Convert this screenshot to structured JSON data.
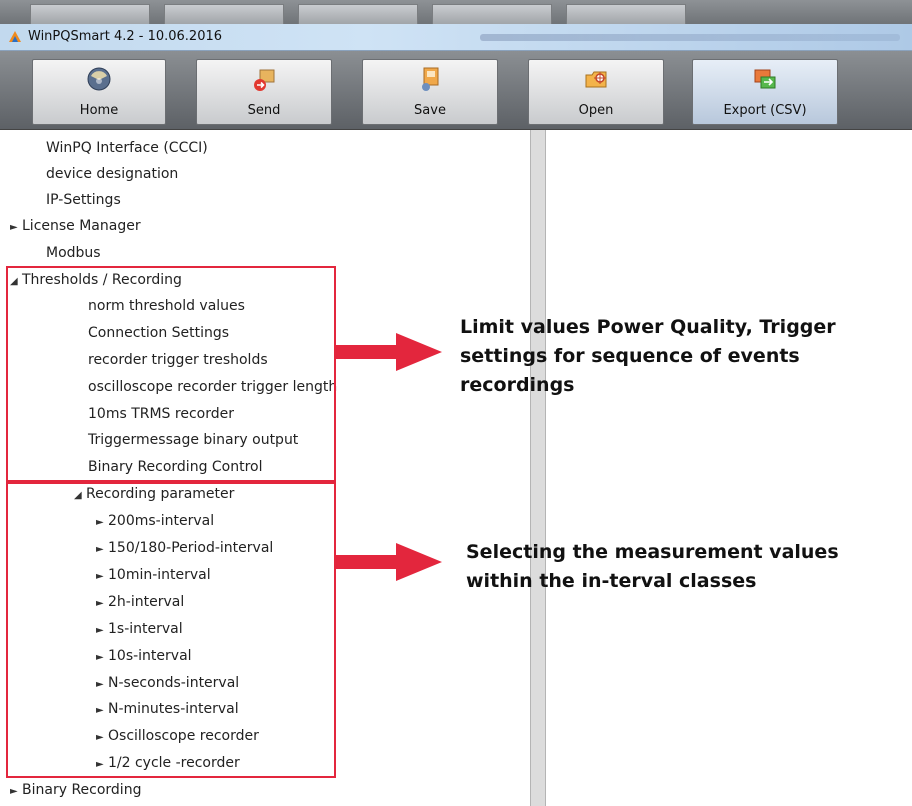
{
  "window": {
    "title": "WinPQSmart  4.2 - 10.06.2016"
  },
  "toolbar": {
    "buttons": [
      {
        "label": "Home",
        "icon": "home-icon"
      },
      {
        "label": "Send",
        "icon": "send-icon"
      },
      {
        "label": "Save",
        "icon": "save-icon"
      },
      {
        "label": "Open",
        "icon": "open-icon"
      },
      {
        "label": "Export (CSV)",
        "icon": "export-icon"
      }
    ]
  },
  "tree": {
    "items": [
      {
        "label": "WinPQ Interface (CCCI)",
        "expander": ""
      },
      {
        "label": "device designation",
        "expander": ""
      },
      {
        "label": "IP-Settings",
        "expander": ""
      },
      {
        "label": "License Manager",
        "expander": "►"
      },
      {
        "label": "Modbus",
        "expander": ""
      },
      {
        "label": "Thresholds / Recording",
        "expander": "◢"
      },
      {
        "label": "norm threshold values",
        "expander": ""
      },
      {
        "label": "Connection Settings",
        "expander": ""
      },
      {
        "label": "recorder trigger tresholds",
        "expander": ""
      },
      {
        "label": "oscilloscope  recorder trigger  length",
        "expander": ""
      },
      {
        "label": "10ms TRMS recorder",
        "expander": ""
      },
      {
        "label": "Triggermessage binary output",
        "expander": ""
      },
      {
        "label": "Binary Recording Control",
        "expander": ""
      },
      {
        "label": "Recording parameter",
        "expander": "◢"
      },
      {
        "label": "200ms-interval",
        "expander": "►"
      },
      {
        "label": "150/180-Period-interval",
        "expander": "►"
      },
      {
        "label": "10min-interval",
        "expander": "►"
      },
      {
        "label": "2h-interval",
        "expander": "►"
      },
      {
        "label": "1s-interval",
        "expander": "►"
      },
      {
        "label": "10s-interval",
        "expander": "►"
      },
      {
        "label": "N-seconds-interval",
        "expander": "►"
      },
      {
        "label": "N-minutes-interval",
        "expander": "►"
      },
      {
        "label": "Oscilloscope recorder",
        "expander": "►"
      },
      {
        "label": "1/2 cycle -recorder",
        "expander": "►"
      },
      {
        "label": "Binary Recording",
        "expander": "►"
      }
    ]
  },
  "annotations": {
    "note1": [
      "Limit values Power Quality, Trigger",
      "settings for sequence of events",
      "recordings"
    ],
    "note2": [
      "Selecting the measurement values",
      "within the in-terval classes"
    ],
    "accent_color": "#e3263d"
  }
}
